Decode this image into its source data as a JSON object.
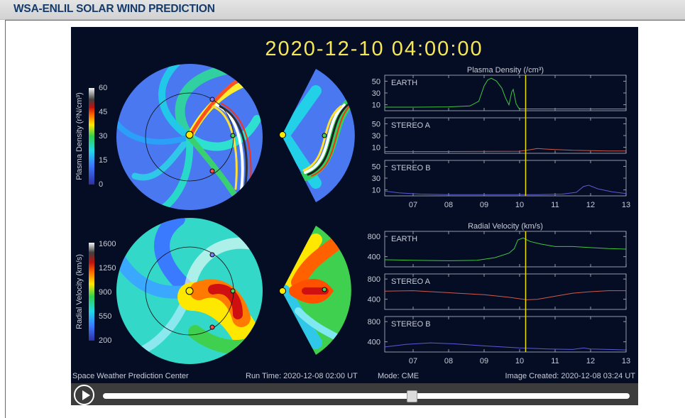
{
  "header": {
    "title": "WSA-ENLIL SOLAR WIND PREDICTION"
  },
  "viewer": {
    "timestamp": "2020-12-10  04:00:00",
    "density_colorbar": {
      "label": "Plasma Density (r²N/cm³)",
      "ticks": [
        "60",
        "45",
        "30",
        "15",
        "0"
      ]
    },
    "velocity_colorbar": {
      "label": "Radial Velocity (km/s)",
      "ticks": [
        "1600",
        "1250",
        "900",
        "550",
        "200"
      ]
    },
    "density_chart_title": "Plasma Density (/cm³)",
    "velocity_chart_title": "Radial Velocity (km/s)",
    "footer": {
      "center": "Space Weather Prediction Center",
      "run_time": "Run Time: 2020-12-08 02:00 UT",
      "mode": "Mode: CME",
      "image_created": "Image Created: 2020-12-08 03:24 UT"
    }
  },
  "chart_data": [
    {
      "type": "line",
      "title": "Plasma Density (/cm³)",
      "x_ticks": [
        "07",
        "08",
        "09",
        "10",
        "11",
        "12",
        "13"
      ],
      "xlim": [
        6.2,
        13
      ],
      "current_time": 10.17,
      "series": [
        {
          "name": "EARTH",
          "ylim": [
            0,
            60
          ],
          "y_ticks": [
            "50",
            "30",
            "10"
          ],
          "color": "#3ec83e",
          "x": [
            6.2,
            7.0,
            8.0,
            8.6,
            8.85,
            9.0,
            9.1,
            9.2,
            9.35,
            9.5,
            9.6,
            9.7,
            9.78,
            9.82,
            9.9,
            9.98,
            10.02,
            10.1,
            10.3,
            11.0,
            12.0,
            13.0
          ],
          "y": [
            6,
            6,
            6.5,
            8,
            16,
            42,
            52,
            55,
            50,
            38,
            22,
            10,
            32,
            36,
            12,
            4,
            3,
            3,
            3,
            3,
            3,
            3
          ]
        },
        {
          "name": "STEREO A",
          "ylim": [
            0,
            60
          ],
          "y_ticks": [
            "50",
            "30",
            "10"
          ],
          "color": "#d05a4a",
          "x": [
            6.2,
            8.0,
            10.0,
            10.2,
            10.5,
            10.8,
            11.5,
            12.5,
            13.0
          ],
          "y": [
            3,
            3,
            3.5,
            5,
            8,
            7,
            5,
            4,
            4
          ]
        },
        {
          "name": "STEREO B",
          "ylim": [
            0,
            60
          ],
          "y_ticks": [
            "50",
            "30",
            "10"
          ],
          "color": "#5a5ad8",
          "x": [
            6.2,
            6.6,
            7.2,
            8.0,
            9.5,
            10.5,
            11.2,
            11.6,
            11.8,
            11.95,
            12.2,
            12.6,
            13.0
          ],
          "y": [
            8,
            5,
            3,
            2,
            2,
            2,
            3,
            6,
            16,
            18,
            12,
            7,
            4
          ]
        }
      ]
    },
    {
      "type": "line",
      "title": "Radial Velocity (km/s)",
      "x_ticks": [
        "07",
        "08",
        "09",
        "10",
        "11",
        "12",
        "13"
      ],
      "xlim": [
        6.2,
        13
      ],
      "current_time": 10.17,
      "series": [
        {
          "name": "EARTH",
          "ylim": [
            200,
            900
          ],
          "y_ticks": [
            "800",
            "400"
          ],
          "color": "#3ec83e",
          "x": [
            6.2,
            7.0,
            8.0,
            8.8,
            9.3,
            9.7,
            9.85,
            9.95,
            10.1,
            10.3,
            10.6,
            11.0,
            11.5,
            12.0,
            12.5,
            13.0
          ],
          "y": [
            340,
            330,
            320,
            330,
            380,
            470,
            560,
            730,
            770,
            700,
            650,
            600,
            600,
            580,
            560,
            550
          ]
        },
        {
          "name": "STEREO A",
          "ylim": [
            200,
            900
          ],
          "y_ticks": [
            "800",
            "400"
          ],
          "color": "#d05a4a",
          "x": [
            6.2,
            7.0,
            8.0,
            9.0,
            9.7,
            10.2,
            10.5,
            11.0,
            11.5,
            12.0,
            12.5,
            13.0
          ],
          "y": [
            560,
            570,
            530,
            490,
            440,
            390,
            400,
            460,
            520,
            550,
            570,
            570
          ]
        },
        {
          "name": "STEREO B",
          "ylim": [
            200,
            900
          ],
          "y_ticks": [
            "800",
            "400"
          ],
          "color": "#5a5ad8",
          "x": [
            6.2,
            6.8,
            7.5,
            8.2,
            9.0,
            10.0,
            10.8,
            11.5,
            11.8,
            12.0,
            12.5,
            13.0
          ],
          "y": [
            300,
            350,
            380,
            360,
            320,
            280,
            260,
            250,
            280,
            260,
            250,
            240
          ]
        }
      ]
    }
  ]
}
